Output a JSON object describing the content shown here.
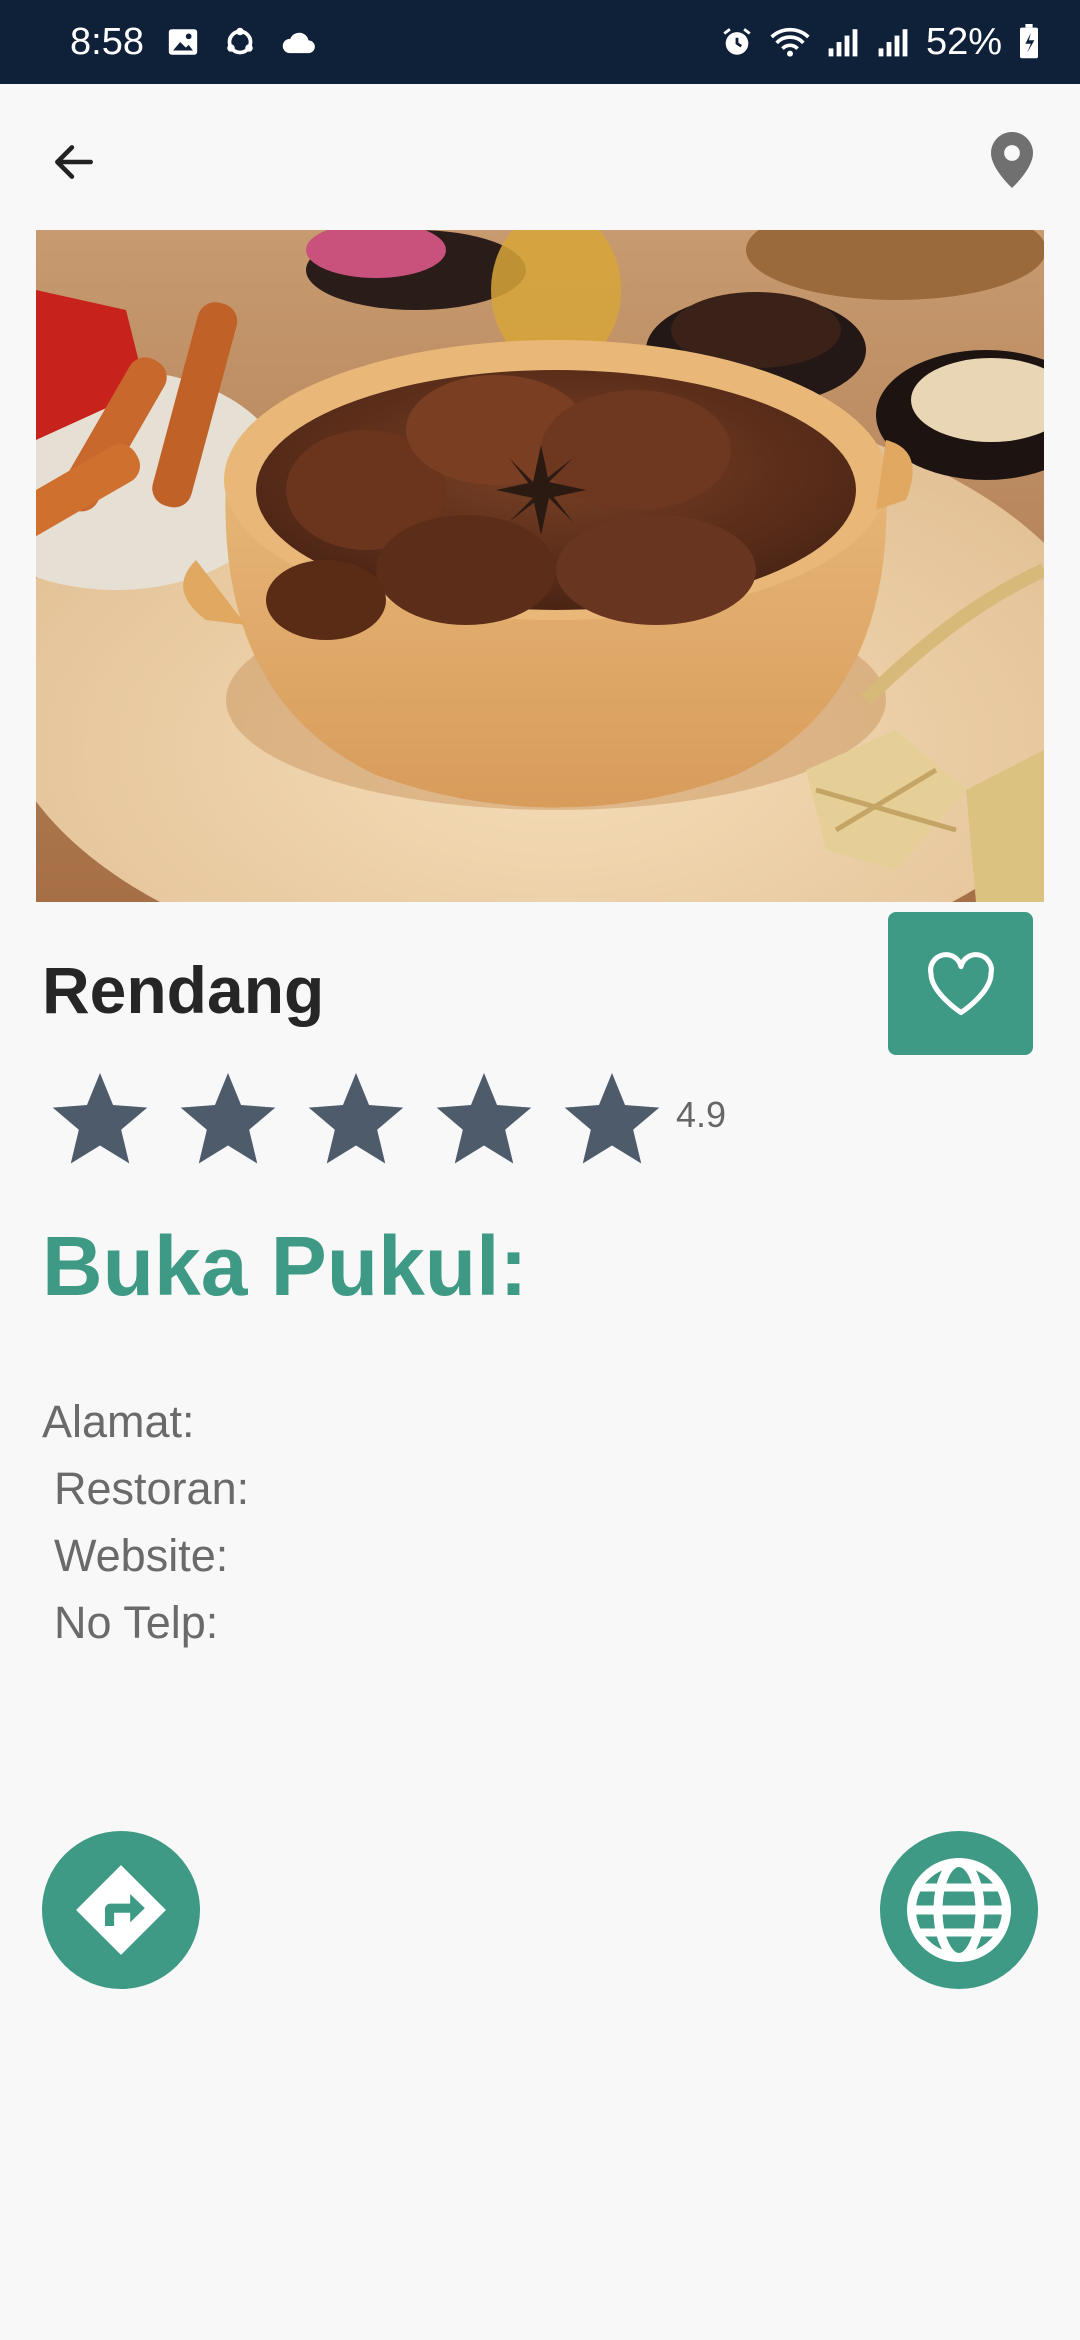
{
  "status_bar": {
    "time": "8:58",
    "battery": "52%",
    "icons": [
      "image-icon",
      "sync-icon",
      "cloud-icon",
      "alarm-icon",
      "wifi-icon",
      "signal-icon",
      "signal-icon",
      "battery-icon"
    ]
  },
  "header": {
    "back_icon": "arrow-left-icon",
    "location_icon": "map-pin-icon"
  },
  "restaurant": {
    "name": "Rendang",
    "rating_value": "4.9",
    "rating": 4.9,
    "max_rating": 5,
    "hours_label": "Buka Pukul:",
    "address_label": "Alamat:",
    "restaurant_label": " Restoran:",
    "website_label": " Website:",
    "phone_label": " No Telp:"
  },
  "actions": {
    "favorite_icon": "heart-icon",
    "directions_icon": "directions-icon",
    "website_icon": "globe-icon"
  },
  "colors": {
    "accent": "#3f9a85",
    "status_bar": "#0f2039",
    "star": "#4e5b6b",
    "background": "#f8f8f8"
  }
}
